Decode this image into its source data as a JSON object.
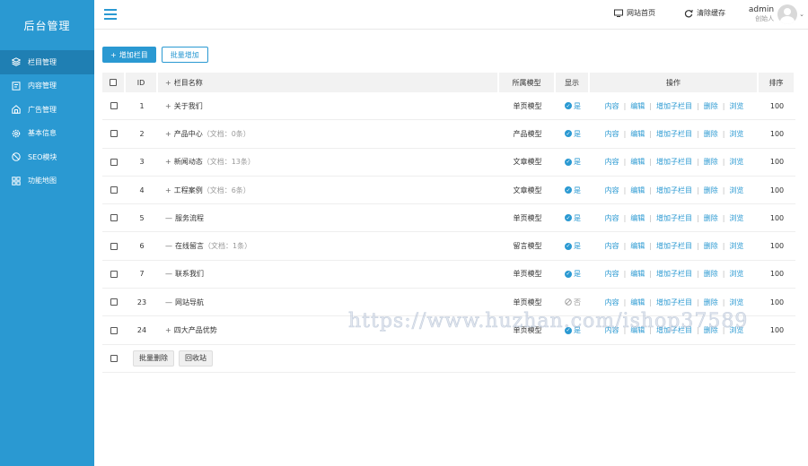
{
  "sidebar": {
    "brand": "后台管理",
    "items": [
      {
        "label": "栏目管理",
        "icon": "layers-icon",
        "active": true
      },
      {
        "label": "内容管理",
        "icon": "document-icon",
        "active": false
      },
      {
        "label": "广告管理",
        "icon": "ad-icon",
        "active": false
      },
      {
        "label": "基本信息",
        "icon": "settings-icon",
        "active": false
      },
      {
        "label": "SEO模块",
        "icon": "seo-icon",
        "active": false
      },
      {
        "label": "功能地图",
        "icon": "grid-icon",
        "active": false
      }
    ]
  },
  "topbar": {
    "home_link": "网站首页",
    "clear_cache": "清除缓存",
    "user_name": "admin",
    "user_role": "创始人"
  },
  "toolbar": {
    "add_label": "增加栏目",
    "batch_add_label": "批量增加"
  },
  "table": {
    "headers": {
      "id": "ID",
      "name": "栏目名称",
      "model": "所属模型",
      "show": "显示",
      "ops": "操作",
      "sort": "排序"
    },
    "ops_labels": [
      "内容",
      "编辑",
      "增加子栏目",
      "删除",
      "浏览"
    ],
    "rows": [
      {
        "id": "1",
        "tree": "+",
        "name": "关于我们",
        "docs": "",
        "model": "单页模型",
        "show": "是",
        "visible": true,
        "sort": "100"
      },
      {
        "id": "2",
        "tree": "+",
        "name": "产品中心",
        "docs": "（文档：0条）",
        "model": "产品模型",
        "show": "是",
        "visible": true,
        "sort": "100"
      },
      {
        "id": "3",
        "tree": "+",
        "name": "新闻动态",
        "docs": "（文档：13条）",
        "model": "文章模型",
        "show": "是",
        "visible": true,
        "sort": "100"
      },
      {
        "id": "4",
        "tree": "+",
        "name": "工程案例",
        "docs": "（文档：6条）",
        "model": "文章模型",
        "show": "是",
        "visible": true,
        "sort": "100"
      },
      {
        "id": "5",
        "tree": "—",
        "name": "服务流程",
        "docs": "",
        "model": "单页模型",
        "show": "是",
        "visible": true,
        "sort": "100"
      },
      {
        "id": "6",
        "tree": "—",
        "name": "在线留言",
        "docs": "（文档：1条）",
        "model": "留言模型",
        "show": "是",
        "visible": true,
        "sort": "100"
      },
      {
        "id": "7",
        "tree": "—",
        "name": "联系我们",
        "docs": "",
        "model": "单页模型",
        "show": "是",
        "visible": true,
        "sort": "100"
      },
      {
        "id": "23",
        "tree": "—",
        "name": "网站导航",
        "docs": "",
        "model": "单页模型",
        "show": "否",
        "visible": false,
        "sort": "100"
      },
      {
        "id": "24",
        "tree": "+",
        "name": "四大产品优势",
        "docs": "",
        "model": "单页模型",
        "show": "是",
        "visible": true,
        "sort": "100"
      }
    ]
  },
  "footer": {
    "batch_delete": "批量删除",
    "recycle": "回收站"
  },
  "watermark": "https://www.huzhan.com/ishop37589"
}
